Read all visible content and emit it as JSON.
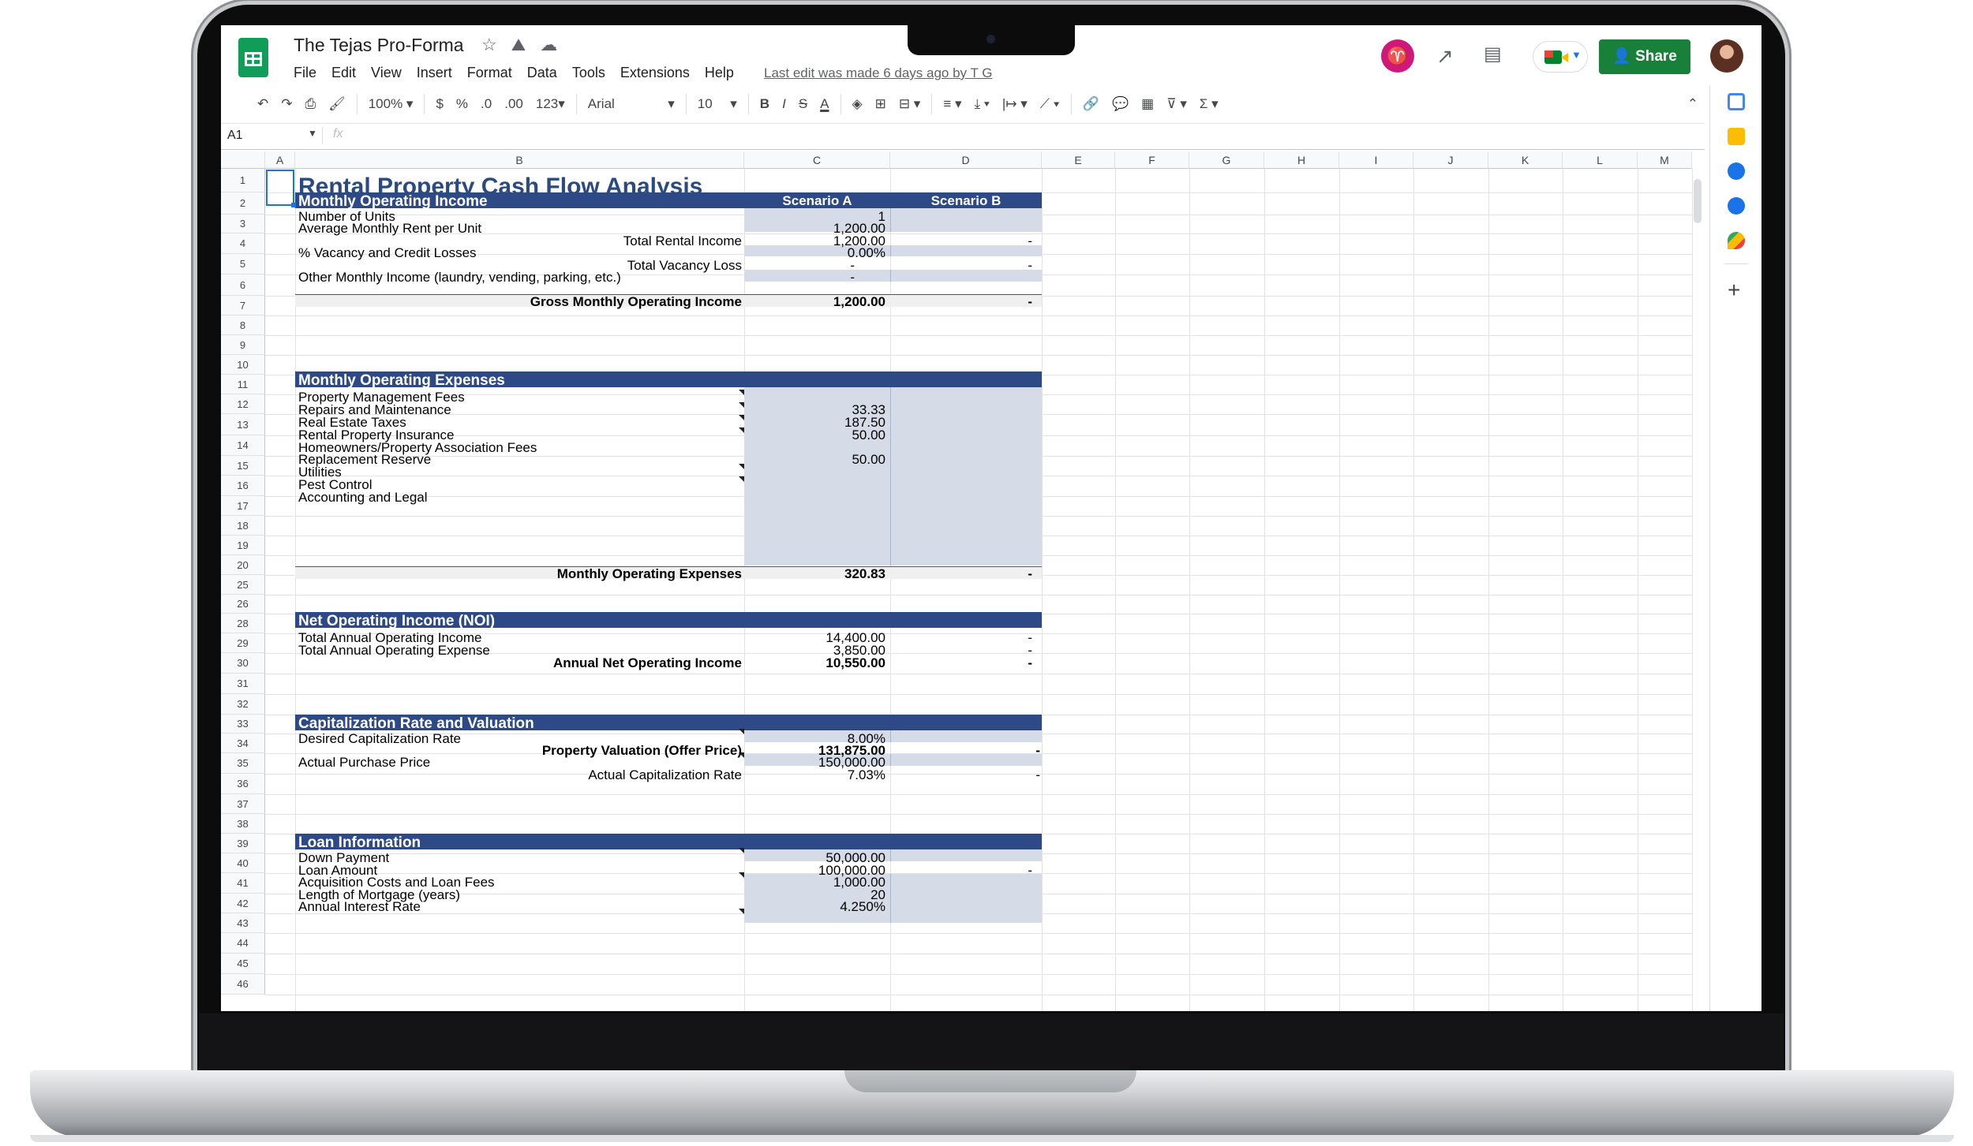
{
  "app": {
    "doc_title": "The Tejas Pro-Forma",
    "menu": [
      "File",
      "Edit",
      "View",
      "Insert",
      "Format",
      "Data",
      "Tools",
      "Extensions",
      "Help"
    ],
    "last_edit": "Last edit was made 6 days ago by T G",
    "share_label": "Share",
    "header_icons": [
      "star-icon",
      "move-to-drive-icon",
      "cloud-saved-icon",
      "activity-trend-icon",
      "comments-icon",
      "meet-icon",
      "account-avatar"
    ]
  },
  "toolbar": {
    "zoom": "100%",
    "currency": "$",
    "percent": "%",
    "decrease_decimals": ".0",
    "increase_decimals": ".00",
    "more_formats": "123",
    "font": "Arial",
    "font_size": "10",
    "bold": "B",
    "italic": "I",
    "strike": "S",
    "text_color": "A"
  },
  "formula_bar": {
    "name_box": "A1",
    "fx": "fx"
  },
  "columns": [
    "A",
    "B",
    "C",
    "D",
    "E",
    "F",
    "G",
    "H",
    "I",
    "J",
    "K",
    "L",
    "M"
  ],
  "rows": [
    "1",
    "2",
    "3",
    "4",
    "5",
    "6",
    "7",
    "8",
    "9",
    "10",
    "11",
    "12",
    "13",
    "14",
    "15",
    "16",
    "17",
    "18",
    "19",
    "20",
    "25",
    "26",
    "28",
    "29",
    "30",
    "31",
    "32",
    "33",
    "34",
    "35",
    "36",
    "37",
    "38",
    "39",
    "40",
    "41",
    "42",
    "43",
    "44",
    "45",
    "46"
  ],
  "sheet": {
    "title": "Rental Property Cash Flow Analysis",
    "income": {
      "header": "Monthly Operating Income",
      "scenario_a": "Scenario A",
      "scenario_b": "Scenario B",
      "units_label": "Number of Units",
      "units_a": "1",
      "rent_label": "Average Monthly Rent per Unit",
      "rent_a": "1,200.00",
      "total_rent_label": "Total Rental Income",
      "total_rent_a": "1,200.00",
      "total_rent_b": "-",
      "vacancy_label": "% Vacancy and Credit Losses",
      "vacancy_a": "0.00%",
      "vacancy_loss_label": "Total Vacancy Loss",
      "vacancy_loss_a": "-",
      "vacancy_loss_b": "-",
      "other_label": "Other Monthly Income (laundry, vending, parking, etc.)",
      "other_a": "-",
      "gross_label": "Gross Monthly Operating Income",
      "gross_a": "1,200.00",
      "gross_b": "-"
    },
    "expenses": {
      "header": "Monthly Operating Expenses",
      "items": [
        {
          "label": "Property Management Fees",
          "a": ""
        },
        {
          "label": "Repairs and Maintenance",
          "a": "33.33"
        },
        {
          "label": "Real Estate Taxes",
          "a": "187.50"
        },
        {
          "label": "Rental Property Insurance",
          "a": "50.00"
        },
        {
          "label": "Homeowners/Property Association Fees",
          "a": ""
        },
        {
          "label": "Replacement Reserve",
          "a": "50.00"
        },
        {
          "label": "Utilities",
          "a": ""
        },
        {
          "label": "Pest Control",
          "a": ""
        },
        {
          "label": "Accounting and Legal",
          "a": ""
        }
      ],
      "total_label": "Monthly Operating Expenses",
      "total_a": "320.83",
      "total_b": "-"
    },
    "noi": {
      "header": "Net Operating Income (NOI)",
      "annual_income_label": "Total Annual Operating Income",
      "annual_income_a": "14,400.00",
      "annual_income_b": "-",
      "annual_expense_label": "Total Annual Operating Expense",
      "annual_expense_a": "3,850.00",
      "annual_expense_b": "-",
      "annual_noi_label": "Annual Net Operating Income",
      "annual_noi_a": "10,550.00",
      "annual_noi_b": "-"
    },
    "cap": {
      "header": "Capitalization Rate and Valuation",
      "desired_label": "Desired Capitalization Rate",
      "desired_a": "8.00%",
      "valuation_label": "Property Valuation (Offer Price)",
      "valuation_a": "131,875.00",
      "valuation_b": "-",
      "purchase_label": "Actual Purchase Price",
      "purchase_a": "150,000.00",
      "actual_rate_label": "Actual Capitalization Rate",
      "actual_rate_a": "7.03%",
      "actual_rate_b": "-"
    },
    "loan": {
      "header": "Loan Information",
      "down_label": "Down Payment",
      "down_a": "50,000.00",
      "amount_label": "Loan Amount",
      "amount_a": "100,000.00",
      "amount_b": "-",
      "fees_label": "Acquisition Costs and Loan Fees",
      "fees_a": "1,000.00",
      "length_label": "Length of Mortgage (years)",
      "length_a": "20",
      "rate_label": "Annual Interest Rate",
      "rate_a": "4.250%"
    }
  },
  "colors": {
    "section_band": "#2e4a86",
    "input_shade": "#d6dbe8",
    "title_text": "#2c4a82",
    "share_green": "#188038"
  }
}
